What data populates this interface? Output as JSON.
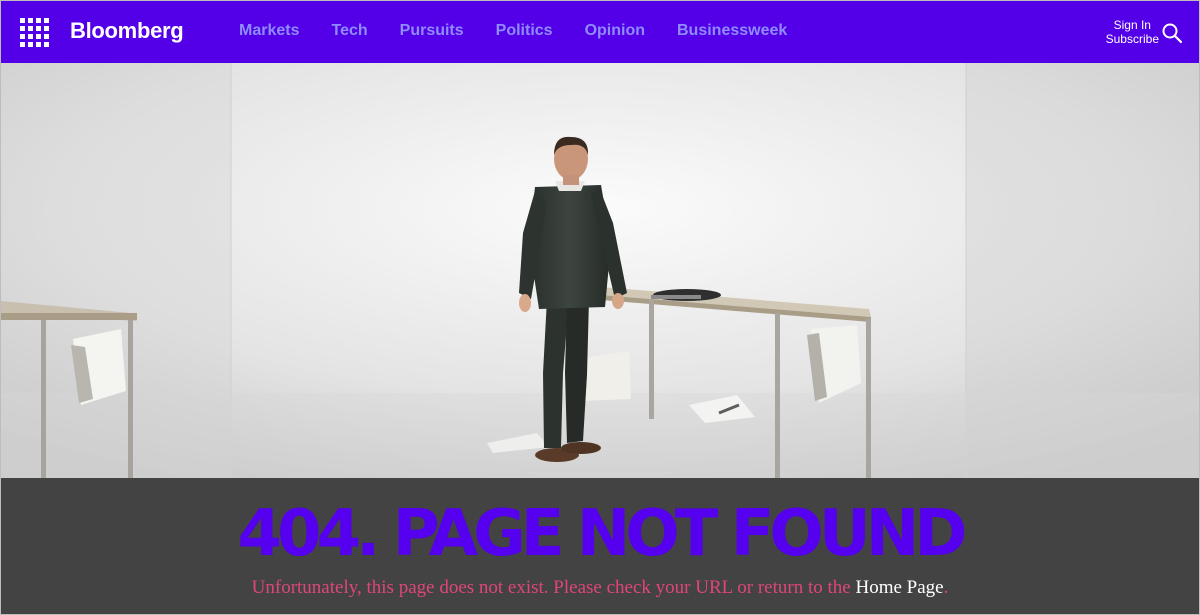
{
  "header": {
    "brand": "Bloomberg",
    "nav": [
      "Markets",
      "Tech",
      "Pursuits",
      "Politics",
      "Opinion",
      "Businessweek"
    ],
    "sign_in": "Sign In",
    "subscribe": "Subscribe",
    "menu_icon": "grid-menu-icon",
    "search_icon": "search-icon"
  },
  "error": {
    "headline": "404. PAGE NOT FOUND",
    "message_before": "Unfortunately, this page does not exist. Please check your URL or return to the ",
    "home_link": "Home Page",
    "message_after": "."
  },
  "colors": {
    "brand": "#5300e8",
    "nav_link": "#8f8cff",
    "band": "#434343",
    "headline": "#5500ee",
    "message": "#e0457a"
  }
}
